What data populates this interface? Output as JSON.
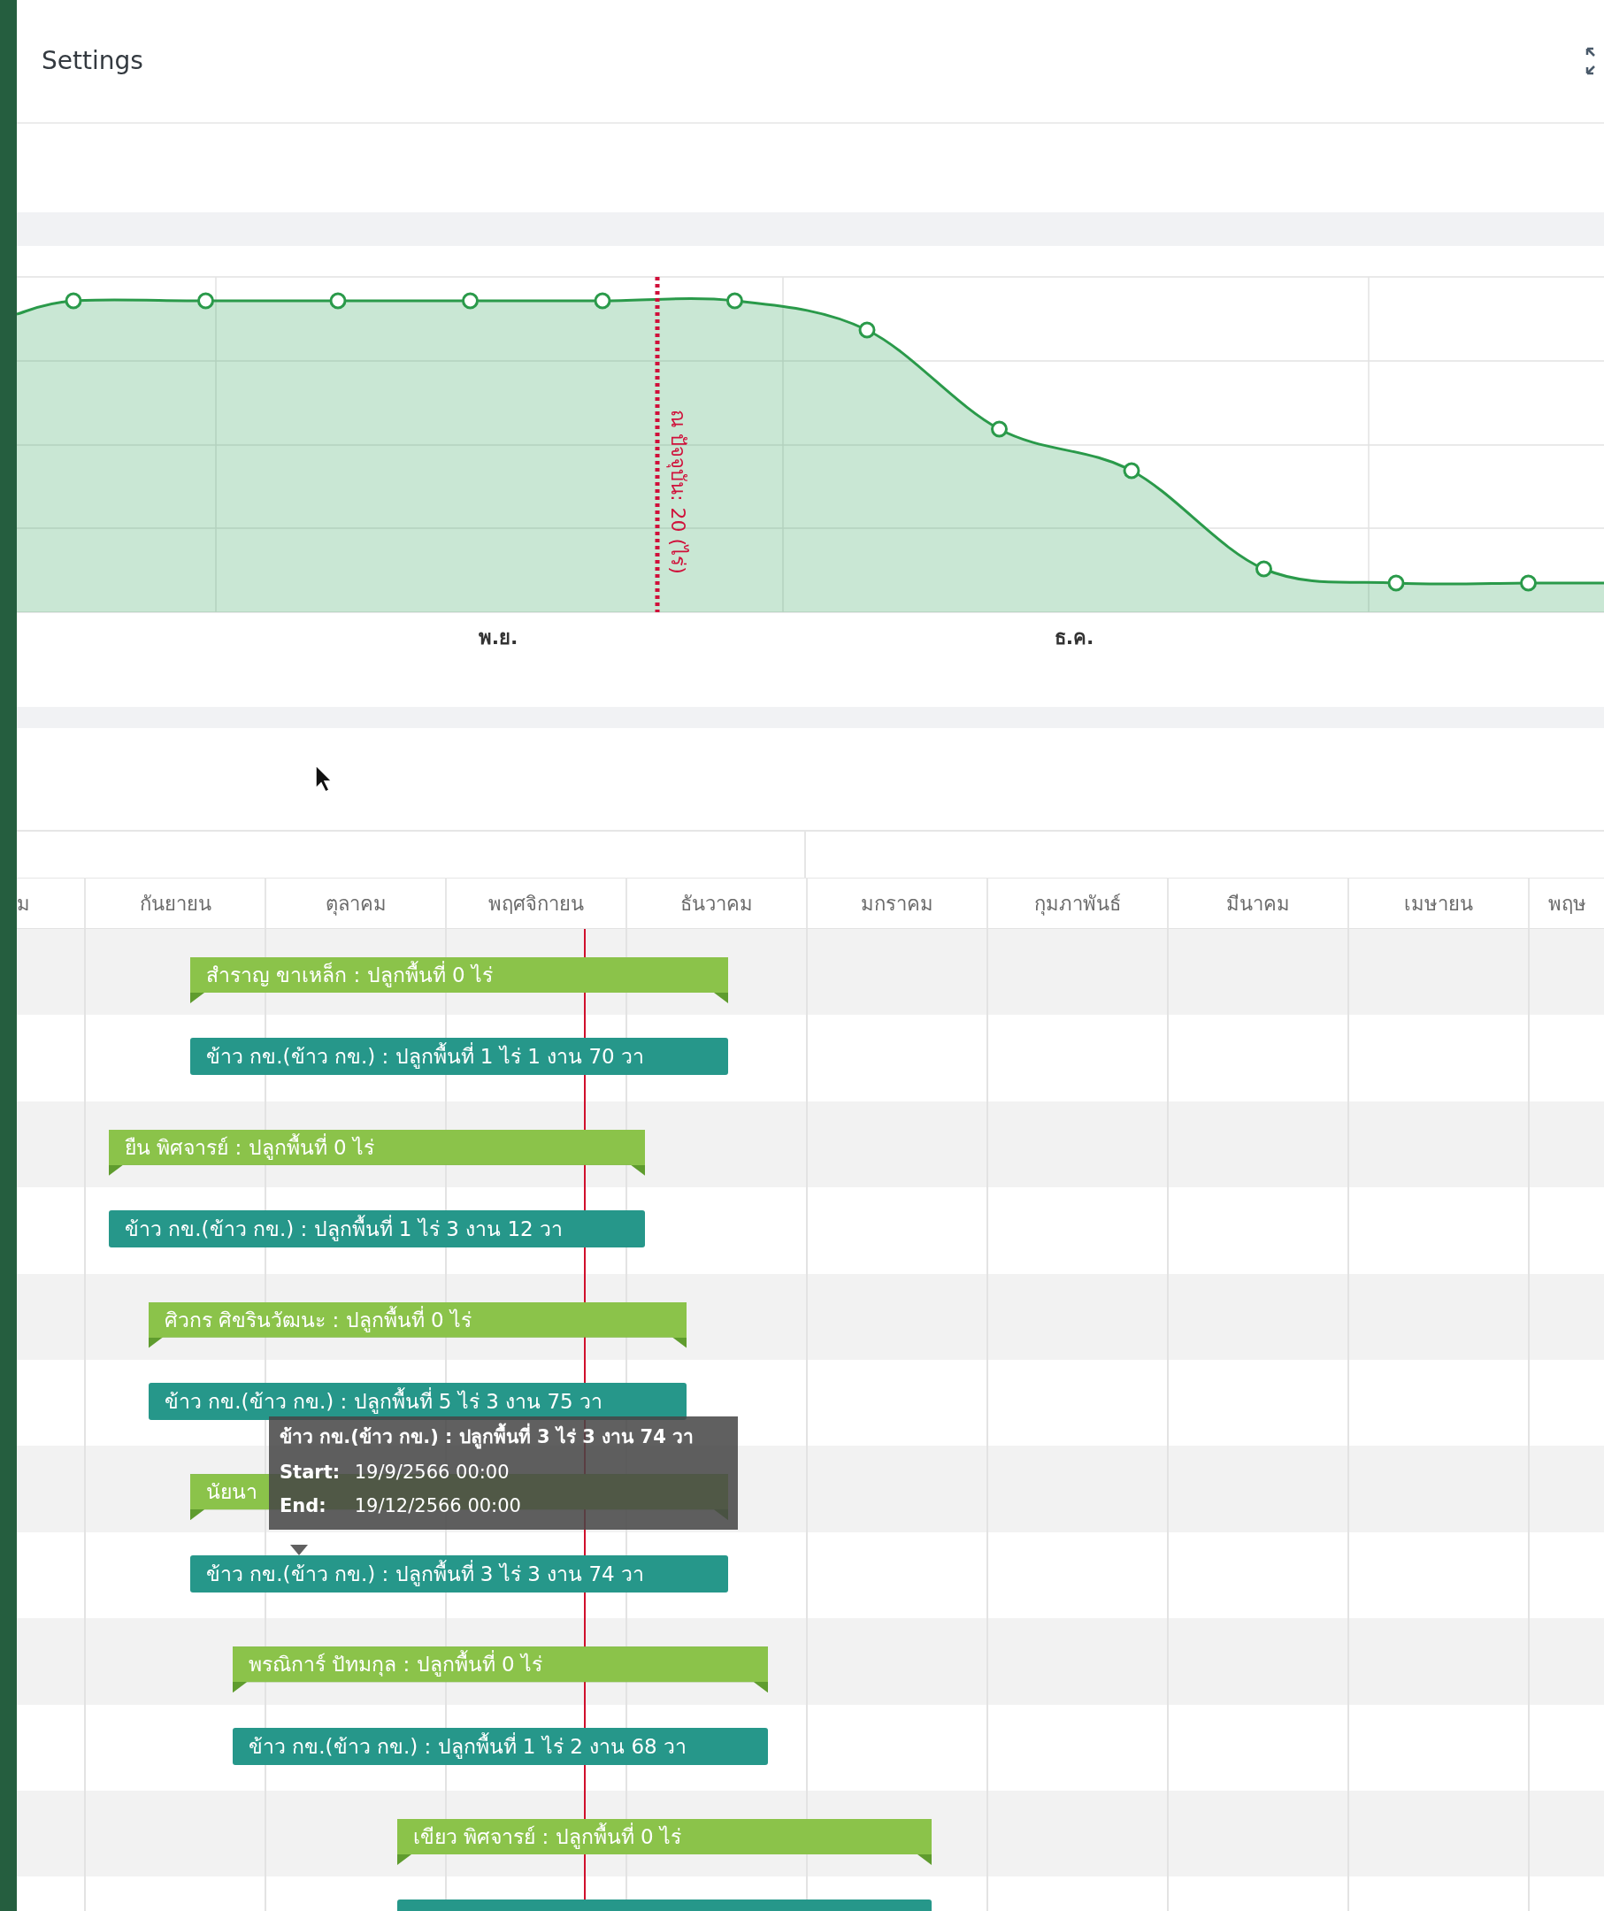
{
  "header": {
    "title": "Settings"
  },
  "area_chart": {
    "marker_label": "ณ ปัจจุบัน: 20 (ไร่)",
    "x_labels": [
      "พ.ย.",
      "ธ.ค."
    ]
  },
  "gantt": {
    "months": [
      "ม",
      "กันยายน",
      "ตุลาคม",
      "พฤศจิกายน",
      "ธันวาคม",
      "มกราคม",
      "กุมภาพันธ์",
      "มีนาคม",
      "เมษายน",
      "พฤษ"
    ],
    "rows": [
      {
        "kind": "owner",
        "label": "สำราญ ขาเหล็ก : ปลูกพื้นที่ 0 ไร่"
      },
      {
        "kind": "crop",
        "label": "ข้าว กข.(ข้าว กข.) : ปลูกพื้นที่ 1 ไร่ 1 งาน 70 วา"
      },
      {
        "kind": "owner",
        "label": "ยืน พิศจารย์ : ปลูกพื้นที่ 0 ไร่"
      },
      {
        "kind": "crop",
        "label": "ข้าว กข.(ข้าว กข.) : ปลูกพื้นที่ 1 ไร่ 3 งาน 12 วา"
      },
      {
        "kind": "owner",
        "label": "ศิวกร ศิขรินวัฒนะ : ปลูกพื้นที่ 0 ไร่"
      },
      {
        "kind": "crop",
        "label": "ข้าว กข.(ข้าว กข.) : ปลูกพื้นที่ 5 ไร่ 3 งาน 75 วา"
      },
      {
        "kind": "owner",
        "label": "นัยนา"
      },
      {
        "kind": "crop",
        "label": "ข้าว กข.(ข้าว กข.) : ปลูกพื้นที่ 3 ไร่ 3 งาน 74 วา"
      },
      {
        "kind": "owner",
        "label": "พรณิการ์ ปัทมกุล : ปลูกพื้นที่ 0 ไร่"
      },
      {
        "kind": "crop",
        "label": "ข้าว กข.(ข้าว กข.) : ปลูกพื้นที่ 1 ไร่ 2 งาน 68 วา"
      },
      {
        "kind": "owner",
        "label": "เขียว พิศจารย์ : ปลูกพื้นที่ 0 ไร่"
      },
      {
        "kind": "crop"
      }
    ],
    "tooltip": {
      "title": "ข้าว กข.(ข้าว กข.) : ปลูกพื้นที่ 3 ไร่ 3 งาน 74 วา",
      "lines": [
        {
          "key": "Start:",
          "value": "19/9/2566 00:00"
        },
        {
          "key": "End:",
          "value": "19/12/2566 00:00"
        }
      ]
    }
  }
}
